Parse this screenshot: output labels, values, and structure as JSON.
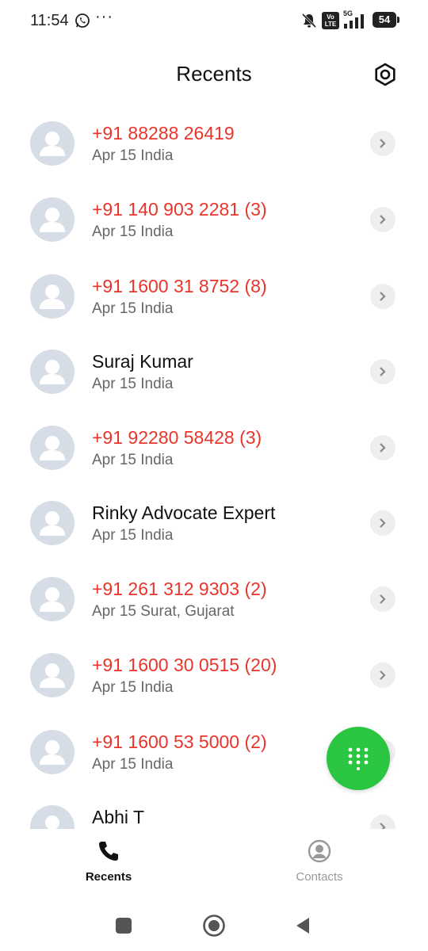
{
  "status_bar": {
    "time": "11:54",
    "network": "5G",
    "volte": "Vo LTE",
    "battery": "54"
  },
  "header": {
    "title": "Recents",
    "settings_icon": "gear-icon"
  },
  "colors": {
    "missed_call": "#e8352b",
    "fab": "#2bc641",
    "avatar_bg": "#d6dde6"
  },
  "calls": [
    {
      "name": "+91 88288 26419",
      "meta": "Apr 15 India",
      "missed": true
    },
    {
      "name": "+91 140 903 2281 (3)",
      "meta": "Apr 15 India",
      "missed": true
    },
    {
      "name": "+91 1600 31 8752 (8)",
      "meta": "Apr 15 India",
      "missed": true
    },
    {
      "name": "Suraj Kumar",
      "meta": "Apr 15 India",
      "missed": false
    },
    {
      "name": "+91 92280 58428 (3)",
      "meta": "Apr 15 India",
      "missed": true
    },
    {
      "name": "Rinky Advocate Expert",
      "meta": "Apr 15 India",
      "missed": false
    },
    {
      "name": "+91 261 312 9303 (2)",
      "meta": "Apr 15 Surat, Gujarat",
      "missed": true
    },
    {
      "name": "+91 1600 30 0515 (20)",
      "meta": "Apr 15 India",
      "missed": true
    },
    {
      "name": "+91 1600 53 5000 (2)",
      "meta": "Apr 15 India",
      "missed": true
    },
    {
      "name": "Abhi T",
      "meta": "",
      "missed": false
    }
  ],
  "bottom_nav": {
    "recents_label": "Recents",
    "contacts_label": "Contacts"
  }
}
